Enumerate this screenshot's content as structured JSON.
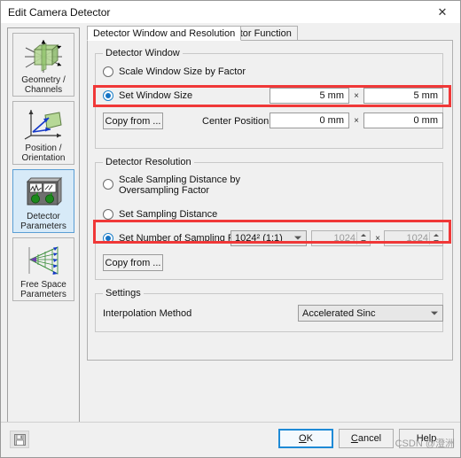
{
  "window": {
    "title": "Edit Camera Detector",
    "close_icon": "close-icon"
  },
  "sidebar": {
    "items": [
      {
        "label": "Geometry /\nChannels",
        "icon": "geometry-channels-icon",
        "selected": false
      },
      {
        "label": "Position /\nOrientation",
        "icon": "position-orientation-icon",
        "selected": false
      },
      {
        "label": "Detector\nParameters",
        "icon": "detector-parameters-icon",
        "selected": true
      },
      {
        "label": "Free Space\nParameters",
        "icon": "free-space-parameters-icon",
        "selected": false
      }
    ]
  },
  "tabs": [
    {
      "label": "Detector Window and Resolution",
      "active": true
    },
    {
      "label": "Detector Function",
      "active": false
    }
  ],
  "detector_window": {
    "group_title": "Detector Window",
    "scale_by_factor": {
      "label": "Scale Window Size by Factor",
      "checked": false
    },
    "set_window_size": {
      "label": "Set Window Size",
      "checked": true
    },
    "window_width": "5 mm",
    "window_height": "5 mm",
    "separator": "×",
    "copy_from_label": "Copy from ...",
    "center_position_label": "Center Position",
    "center_x": "0 mm",
    "center_y": "0 mm"
  },
  "detector_resolution": {
    "group_title": "Detector Resolution",
    "scale_sampling_distance": {
      "label": "Scale Sampling Distance by\nOversampling Factor",
      "checked": false
    },
    "set_sampling_distance": {
      "label": "Set Sampling Distance",
      "checked": false
    },
    "set_number_points": {
      "label": "Set Number of Sampling Points",
      "checked": true
    },
    "preset_value": "1024² (1:1)",
    "points_x": "1024",
    "points_y": "1024",
    "separator": "×",
    "copy_from_label": "Copy from ..."
  },
  "settings": {
    "group_title": "Settings",
    "interpolation_label": "Interpolation Method",
    "interpolation_value": "Accelerated Sinc"
  },
  "footer": {
    "save_icon": "save-icon",
    "ok": "OK",
    "ok_accel": "O",
    "ok_rest": "K",
    "cancel_accel": "C",
    "cancel_rest": "ancel",
    "help": "Help",
    "watermark": "CSDN @澄洲"
  },
  "colors": {
    "highlight": "#f03838",
    "accent": "#1e8ad6",
    "selected_item": "#d7eaf8"
  }
}
